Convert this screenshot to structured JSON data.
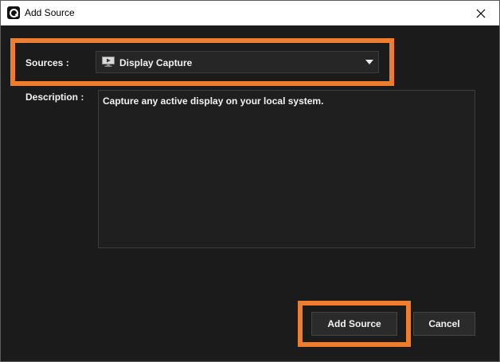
{
  "window": {
    "title": "Add Source",
    "app_icon": "app-logo-icon",
    "close_icon": "close-icon"
  },
  "form": {
    "sources_label": "Sources :",
    "sources_selected": "Display Capture",
    "sources_selected_icon": "display-icon",
    "description_label": "Description :",
    "description_text": "Capture any active display on your local system."
  },
  "actions": {
    "add_source_label": "Add Source",
    "cancel_label": "Cancel"
  },
  "colors": {
    "highlight": "#ef7d2d",
    "background": "#1b1b1b"
  }
}
